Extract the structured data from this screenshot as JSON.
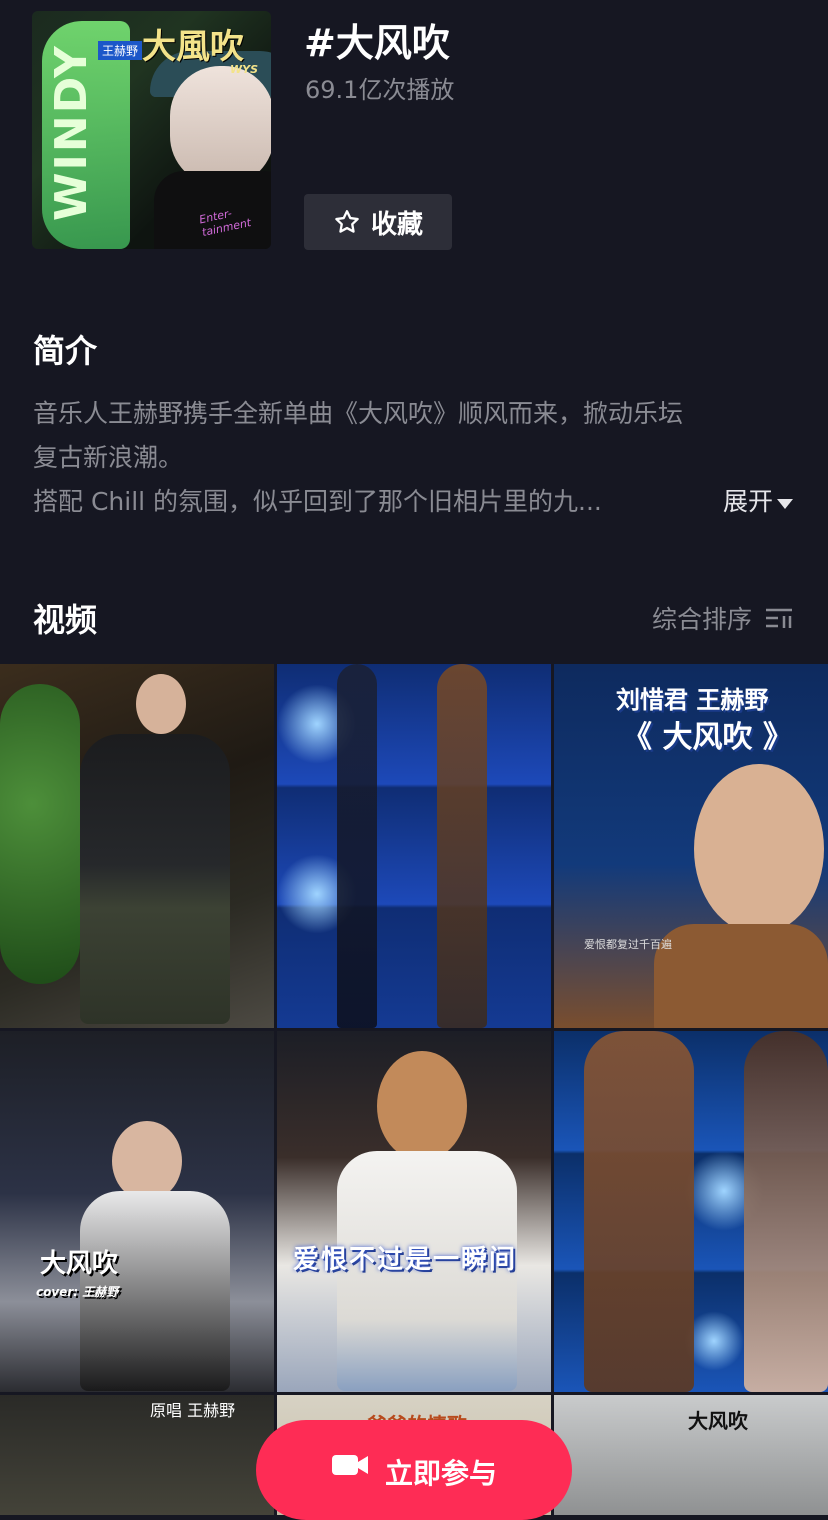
{
  "header": {
    "title": "#大风吹",
    "plays": "69.1亿次播放",
    "favorite_label": "收藏",
    "cover": {
      "song_text": "大風吹",
      "artist_text": "王赫野",
      "windy_text": "WINDY",
      "wys_text": "WYS",
      "ent_text": "Enter-tainment"
    }
  },
  "intro": {
    "title": "简介",
    "line1": "音乐人王赫野携手全新单曲《大风吹》顺风而来，掀动乐坛",
    "line2": "复古新浪潮。",
    "line3": "搭配 Chill 的氛围，似乎回到了那个旧相片里的九...",
    "expand_label": "展开"
  },
  "videos": {
    "title": "视频",
    "sort_label": "综合排序",
    "tiles": [
      {
        "caption": ""
      },
      {
        "caption": ""
      },
      {
        "caption1": "刘惜君 王赫野",
        "caption2": "《 大风吹 》",
        "small": "爱恨都复过千百遍"
      },
      {
        "caption1": "大风吹",
        "caption2": "cover: 王赫野"
      },
      {
        "caption1": "爱恨不过是一瞬间"
      },
      {
        "caption": ""
      },
      {
        "caption1": "原唱 王赫野"
      },
      {
        "caption1": "爸爸的情歌"
      },
      {
        "caption1": "大风吹"
      }
    ]
  },
  "join": {
    "label": "立即参与"
  },
  "colors": {
    "background": "#161722",
    "accent": "#fe2c55",
    "muted_text": "#8a8b93"
  }
}
